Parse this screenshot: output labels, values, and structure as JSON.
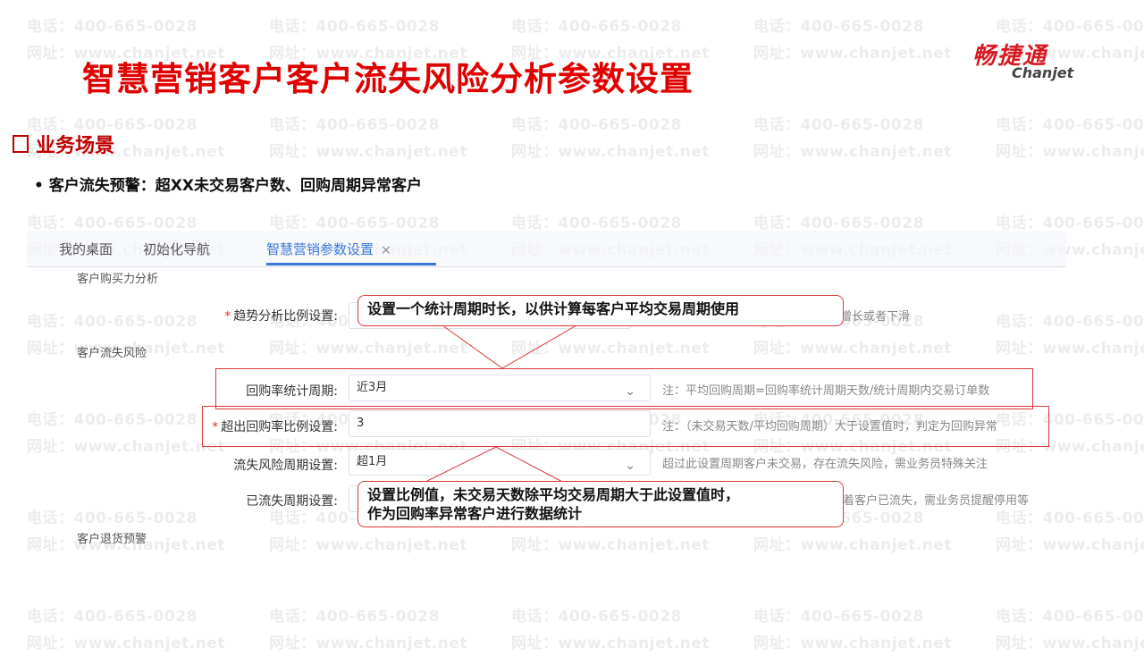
{
  "watermark": {
    "phone": "电话：400-665-0028",
    "site": "网址：www.chanjet.net"
  },
  "slide": {
    "title": "智慧营销客户客户流失风险分析参数设置",
    "logo": {
      "cn": "畅捷通",
      "en": "Chanjet"
    },
    "section": "业务场景",
    "bullet": {
      "bold": "客户流失预警：",
      "text": "超XX未交易客户数、回购周期异常客户"
    }
  },
  "tabs": [
    {
      "label": "我的桌面"
    },
    {
      "label": "初始化导航"
    },
    {
      "label": "智慧营销参数设置",
      "close": "×"
    }
  ],
  "groups": {
    "purchase": "客户购买力分析",
    "churn": "客户流失风险",
    "returns": "客户退货预警"
  },
  "form": {
    "trend": {
      "label": "趋势分析比例设置:",
      "note": "增长或者下滑"
    },
    "repurchase_period": {
      "label": "回购率统计周期:",
      "value": "近3月",
      "note": "注：平均回购周期=回购率统计周期天数/统计周期内交易订单数"
    },
    "exceed_ratio": {
      "label": "超出回购率比例设置:",
      "value": "3",
      "note": "注：（未交易天数/平均回购周期）大于设置值时，判定为回购异常"
    },
    "churn_risk_period": {
      "label": "流失风险周期设置:",
      "value": "超1月",
      "note": "超过此设置周期客户未交易，存在流失风险，需业务员特殊关注"
    },
    "lost_period": {
      "label": "已流失周期设置:",
      "note": "志着客户已流失，需业务员提醒停用等"
    }
  },
  "callouts": {
    "top": "设置一个统计周期时长，以供计算每客户平均交易周期使用",
    "bottom_line1": "设置比例值，未交易天数除平均交易周期大于此设置值时，",
    "bottom_line2": "作为回购率异常客户进行数据统计"
  },
  "icons": {
    "chevron": "chevron-down-icon",
    "close": "close-icon"
  },
  "colors": {
    "title_red": "#e00000",
    "accent_blue": "#3a78d8",
    "frame_red": "#d93a3a"
  }
}
